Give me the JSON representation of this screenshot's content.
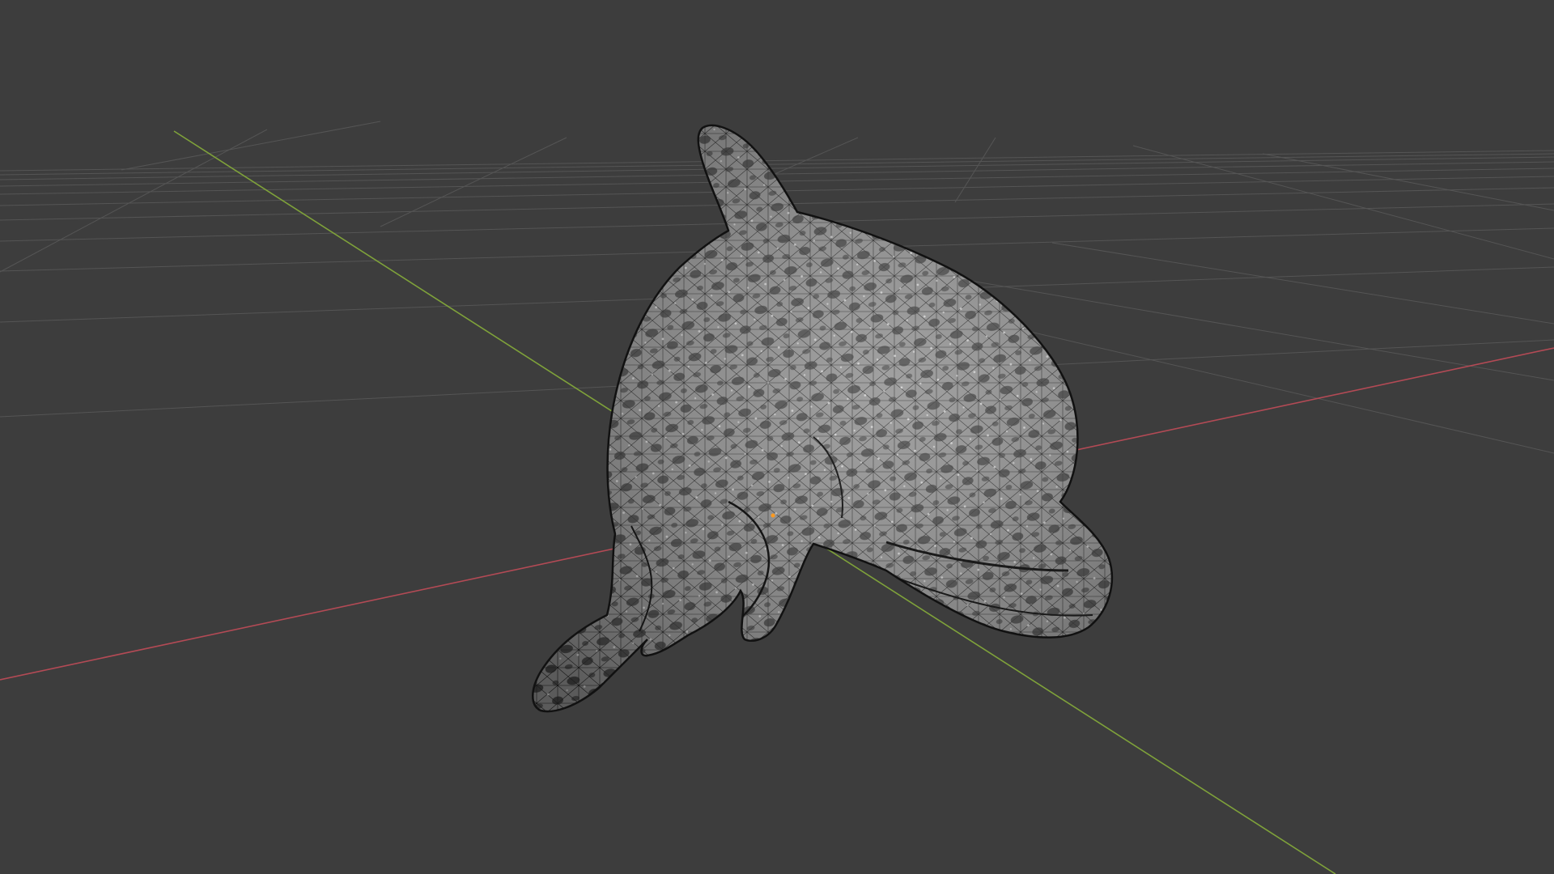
{
  "viewport": {
    "background": "#3d3d3d",
    "grid_color": "#555555",
    "x_axis_color": "#b34a55",
    "y_axis_color": "#7fa23a",
    "mesh_fill": "#8a8a8a",
    "mesh_wire": "#1c1c1c",
    "object": "dolphin-mesh",
    "shading": "wireframe-overlay",
    "origin_marker_color": "#ff9a1f"
  }
}
